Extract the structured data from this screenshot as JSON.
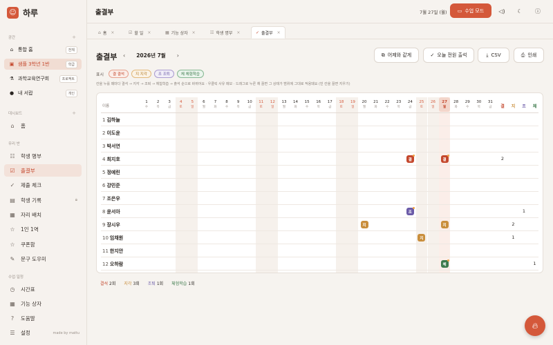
{
  "app": {
    "name": "하루",
    "made_by": "made by mattu"
  },
  "sidebar": {
    "section_space": "공간",
    "workspaces": [
      {
        "label": "통합 홈",
        "tag": "전체",
        "icon": "house-icon"
      },
      {
        "label": "샘플 3학년 1반",
        "tag": "학급",
        "icon": "school-icon"
      },
      {
        "label": "과학교육연구회",
        "tag": "프로젝트",
        "icon": "flask-icon"
      },
      {
        "label": "내 서랍",
        "tag": "개인",
        "icon": "person-icon"
      }
    ],
    "section_dashboard": "대시보드",
    "home": "홈",
    "section_our_class": "우리 반",
    "class_items": [
      "학생 명부",
      "출결부",
      "제출 체크",
      "학생 기록",
      "자리 배치",
      "1인 1역",
      "쿠폰함",
      "문구 도우미"
    ],
    "section_schedule": "수업·일정",
    "schedule_items": [
      "시간표",
      "기능 상자",
      "도움말",
      "설정"
    ]
  },
  "topbar": {
    "title": "출결부",
    "date": "7월 27일 (월)",
    "class_mode": "수업 모드"
  },
  "tabs": [
    {
      "label": "홈",
      "icon": "home-icon"
    },
    {
      "label": "할 일",
      "icon": "checklist-icon"
    },
    {
      "label": "기능 상자",
      "icon": "grid-icon"
    },
    {
      "label": "학생 명부",
      "icon": "people-icon"
    },
    {
      "label": "출결부",
      "icon": "check-circle-icon"
    }
  ],
  "main": {
    "title": "출결부",
    "month": "2026년 7월",
    "buttons": {
      "copy_yesterday": "어제와 같게",
      "all_present": "오늘 전원 출석",
      "csv": "CSV",
      "print": "인쇄"
    },
    "legend_label": "표시",
    "legend": [
      {
        "code": "결",
        "label": "결 결석",
        "cls": "a"
      },
      {
        "code": "지",
        "label": "지 지각",
        "cls": "l"
      },
      {
        "code": "조",
        "label": "조 조퇴",
        "cls": "e"
      },
      {
        "code": "체",
        "label": "체 체험학습",
        "cls": "f"
      }
    ],
    "hint": "칸을 누를 때마다 결석 → 지각 → 조퇴 → 체험학습 → 출석 순으로 바뀌어요 · 우클릭 사유 메모 · 드래그로 누른 채 끌면 그 상태가 범위에 그대로 적용돼요 (빈 칸을 끌면 지우기)"
  },
  "table": {
    "name_header": "이름",
    "days": [
      {
        "d": "1",
        "w": "수"
      },
      {
        "d": "2",
        "w": "목"
      },
      {
        "d": "3",
        "w": "금"
      },
      {
        "d": "4",
        "w": "토"
      },
      {
        "d": "5",
        "w": "일"
      },
      {
        "d": "6",
        "w": "월"
      },
      {
        "d": "7",
        "w": "화"
      },
      {
        "d": "8",
        "w": "수"
      },
      {
        "d": "9",
        "w": "목"
      },
      {
        "d": "10",
        "w": "금"
      },
      {
        "d": "11",
        "w": "토"
      },
      {
        "d": "12",
        "w": "일"
      },
      {
        "d": "13",
        "w": "월"
      },
      {
        "d": "14",
        "w": "화"
      },
      {
        "d": "15",
        "w": "수"
      },
      {
        "d": "16",
        "w": "목"
      },
      {
        "d": "17",
        "w": "금"
      },
      {
        "d": "18",
        "w": "토"
      },
      {
        "d": "19",
        "w": "일"
      },
      {
        "d": "20",
        "w": "월"
      },
      {
        "d": "21",
        "w": "화"
      },
      {
        "d": "22",
        "w": "수"
      },
      {
        "d": "23",
        "w": "목"
      },
      {
        "d": "24",
        "w": "금"
      },
      {
        "d": "25",
        "w": "토"
      },
      {
        "d": "26",
        "w": "일"
      },
      {
        "d": "27",
        "w": "월"
      },
      {
        "d": "28",
        "w": "화"
      },
      {
        "d": "29",
        "w": "수"
      },
      {
        "d": "30",
        "w": "목"
      },
      {
        "d": "31",
        "w": "금"
      }
    ],
    "summary_headers": [
      {
        "label": "결",
        "color": "#c4472c"
      },
      {
        "label": "지",
        "color": "#c98e3b"
      },
      {
        "label": "조",
        "color": "#6b5ba8"
      },
      {
        "label": "체",
        "color": "#3d7a4c"
      }
    ],
    "students": [
      {
        "num": "1",
        "name": "김하늘",
        "marks": [],
        "sums": [
          "",
          "",
          "",
          ""
        ]
      },
      {
        "num": "2",
        "name": "이도윤",
        "marks": [],
        "sums": [
          "",
          "",
          "",
          ""
        ]
      },
      {
        "num": "3",
        "name": "박서연",
        "marks": [],
        "sums": [
          "",
          "",
          "",
          ""
        ]
      },
      {
        "num": "4",
        "name": "최지호",
        "marks": [
          {
            "day": 24,
            "code": "결",
            "cls": "a",
            "memo": true
          },
          {
            "day": 27,
            "code": "결",
            "cls": "a",
            "memo": true
          }
        ],
        "sums": [
          "2",
          "",
          "",
          ""
        ]
      },
      {
        "num": "5",
        "name": "정예린",
        "marks": [],
        "sums": [
          "",
          "",
          "",
          ""
        ]
      },
      {
        "num": "6",
        "name": "강민준",
        "marks": [],
        "sums": [
          "",
          "",
          "",
          ""
        ]
      },
      {
        "num": "7",
        "name": "조은우",
        "marks": [],
        "sums": [
          "",
          "",
          "",
          ""
        ]
      },
      {
        "num": "8",
        "name": "윤서아",
        "marks": [
          {
            "day": 24,
            "code": "조",
            "cls": "e",
            "memo": true
          }
        ],
        "sums": [
          "",
          "",
          "1",
          ""
        ]
      },
      {
        "num": "9",
        "name": "장시우",
        "marks": [
          {
            "day": 20,
            "code": "지",
            "cls": "l",
            "memo": false
          },
          {
            "day": 27,
            "code": "지",
            "cls": "l",
            "memo": false
          }
        ],
        "sums": [
          "",
          "2",
          "",
          ""
        ]
      },
      {
        "num": "10",
        "name": "임채원",
        "marks": [
          {
            "day": 25,
            "code": "지",
            "cls": "l",
            "memo": false
          }
        ],
        "sums": [
          "",
          "1",
          "",
          ""
        ]
      },
      {
        "num": "11",
        "name": "한지안",
        "marks": [],
        "sums": [
          "",
          "",
          "",
          ""
        ]
      },
      {
        "num": "12",
        "name": "오하람",
        "marks": [
          {
            "day": 27,
            "code": "체",
            "cls": "f",
            "memo": true
          }
        ],
        "sums": [
          "",
          "",
          "",
          "1"
        ]
      }
    ]
  },
  "summary": [
    {
      "label": "결석",
      "value": "2회",
      "color": "#c4472c"
    },
    {
      "label": "지각",
      "value": "3회",
      "color": "#c98e3b"
    },
    {
      "label": "조퇴",
      "value": "1회",
      "color": "#6b5ba8"
    },
    {
      "label": "체험학습",
      "value": "1회",
      "color": "#3d7a4c"
    }
  ]
}
